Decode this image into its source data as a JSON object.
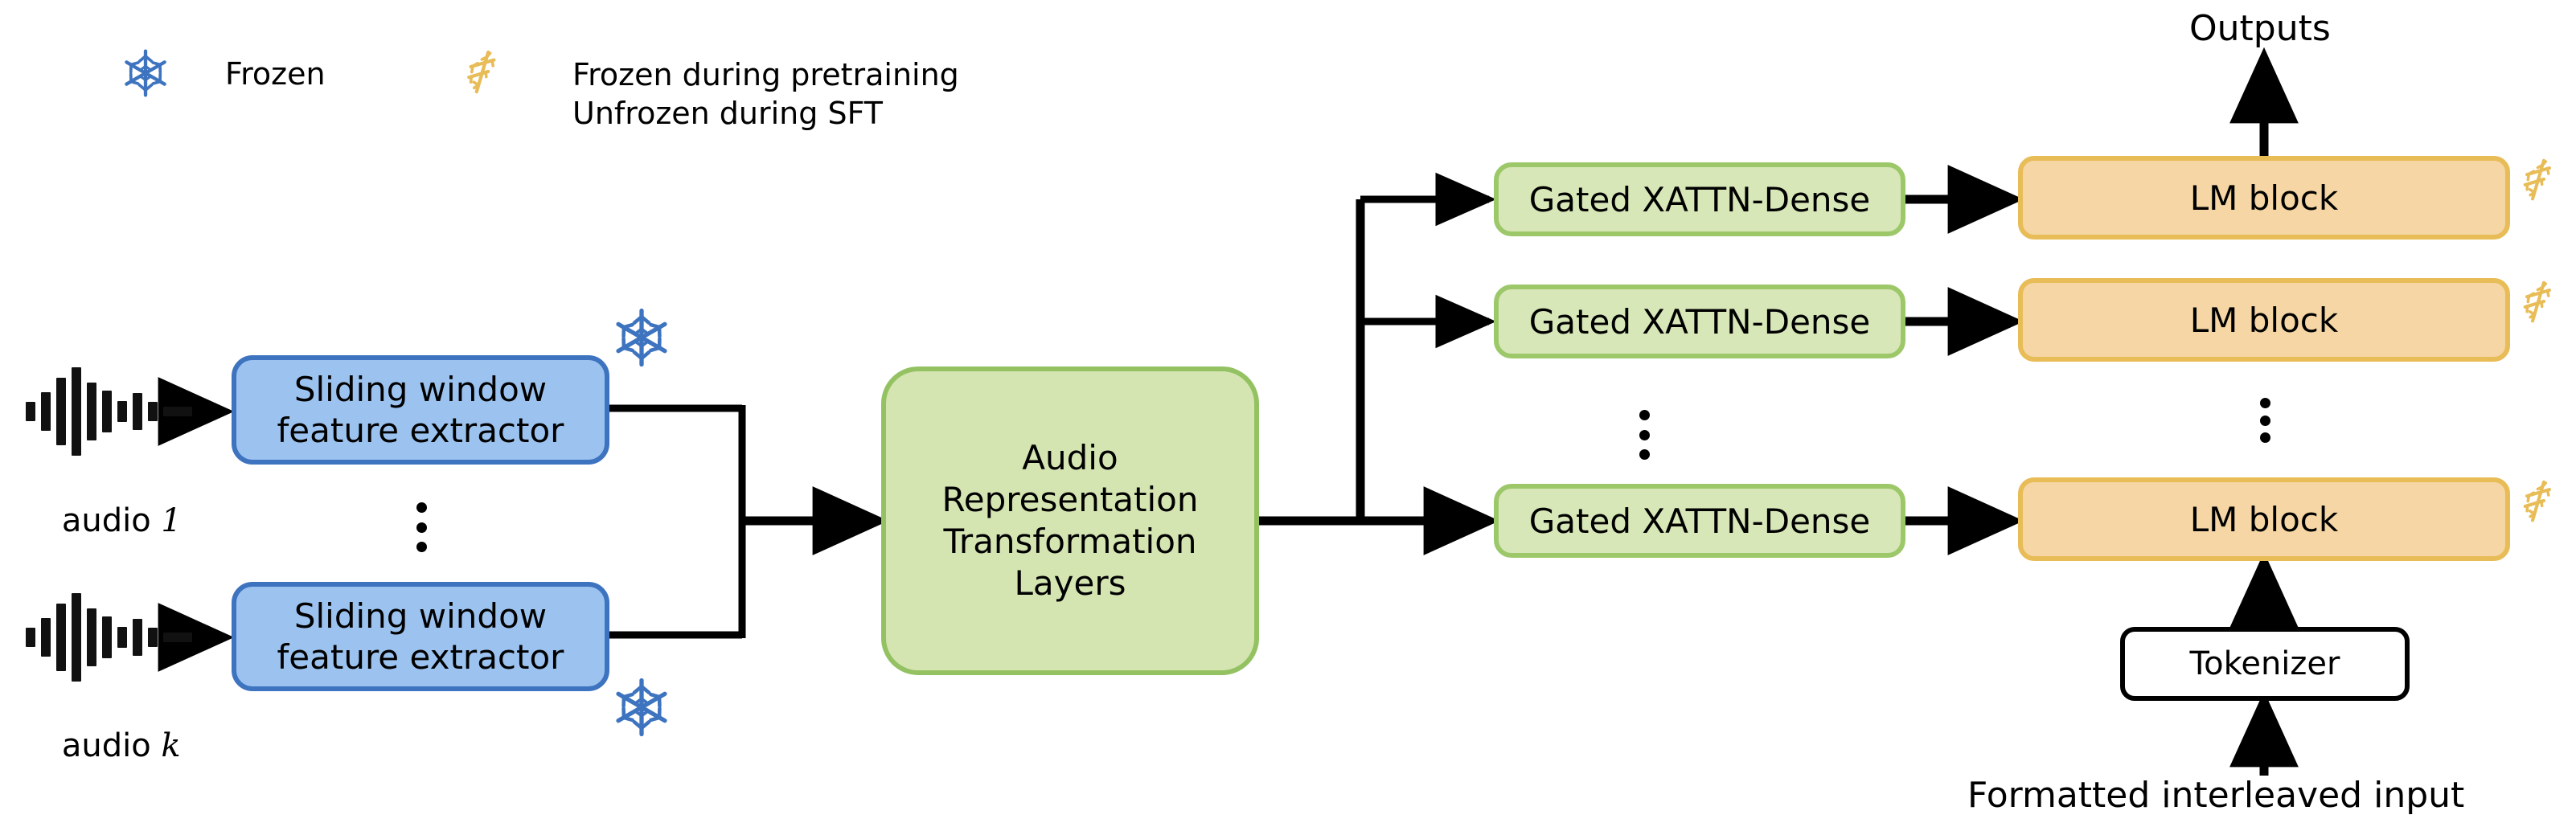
{
  "figure": {
    "type": "architecture-diagram",
    "title": "Audio-language model architecture"
  },
  "legend": {
    "frozen": {
      "icon": "snowflake-icon",
      "color": "#3E74BF",
      "label": "Frozen"
    },
    "partial": {
      "icon": "snowflake-melting-icon",
      "color": "#E8BC57",
      "label_line1": "Frozen during pretraining",
      "label_line2": "Unfrozen during SFT"
    }
  },
  "inputs": {
    "audio": [
      {
        "icon": "audio-waveform-icon",
        "label": "audio 1",
        "label_plain": "audio ",
        "label_italic": "1"
      },
      {
        "icon": "audio-waveform-icon",
        "label": "audio k",
        "label_plain": "audio ",
        "label_italic": "k"
      }
    ],
    "ellipsis": "⋮",
    "text_input_label": "Formatted interleaved input"
  },
  "blocks": {
    "feature_extractors": [
      {
        "label_line1": "Sliding window",
        "label_line2": "feature extractor",
        "state": "frozen",
        "color": "#9CC3F0",
        "border": "#3E74BF"
      },
      {
        "label_line1": "Sliding window",
        "label_line2": "feature extractor",
        "state": "frozen",
        "color": "#9CC3F0",
        "border": "#3E74BF"
      }
    ],
    "transform": {
      "label_line1": "Audio",
      "label_line2": "Representation",
      "label_line3": "Transformation",
      "label_line4": "Layers",
      "color": "#D4E5B2",
      "border": "#94C262"
    },
    "xattn": [
      {
        "label": "Gated XATTN-Dense",
        "color": "#D7E7B8",
        "border": "#9DC86A"
      },
      {
        "label": "Gated XATTN-Dense",
        "color": "#D7E7B8",
        "border": "#9DC86A"
      },
      {
        "label": "Gated XATTN-Dense",
        "color": "#D7E7B8",
        "border": "#9DC86A"
      }
    ],
    "lm_blocks": [
      {
        "label": "LM block",
        "state": "partial",
        "color": "#F5D6A4",
        "border": "#E8BC57"
      },
      {
        "label": "LM block",
        "state": "partial",
        "color": "#F5D6A4",
        "border": "#E8BC57"
      },
      {
        "label": "LM block",
        "state": "partial",
        "color": "#F5D6A4",
        "border": "#E8BC57"
      }
    ],
    "tokenizer": {
      "label": "Tokenizer",
      "color": "#ffffff",
      "border": "#000000"
    }
  },
  "outputs": {
    "label": "Outputs"
  },
  "ellipses": {
    "audio_stack": "⋮",
    "xattn_stack": "⋮",
    "lm_stack": "⋮"
  }
}
